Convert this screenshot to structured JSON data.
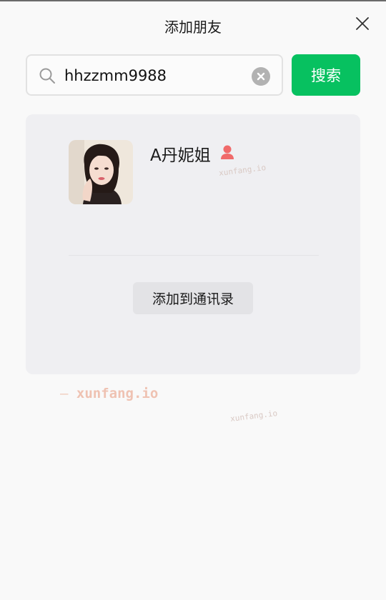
{
  "window": {
    "title": "添加朋友"
  },
  "search": {
    "value": "hhzzmm9988",
    "button_label": "搜索"
  },
  "result": {
    "name": "A丹妮姐",
    "gender": "female",
    "add_label": "添加到通讯录"
  },
  "watermark": {
    "small": "xunfang.io",
    "main_dash": "—",
    "main": "xunfang.io"
  },
  "colors": {
    "accent": "#07c160",
    "female": "#f06a6a",
    "card_bg": "#efeff2"
  },
  "icons": {
    "close": "close-icon",
    "search": "search-icon",
    "clear": "clear-icon",
    "gender": "female-icon"
  }
}
